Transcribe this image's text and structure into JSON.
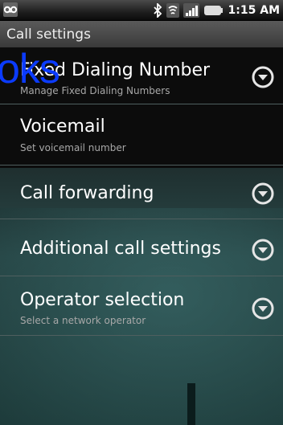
{
  "status_bar": {
    "time": "1:15 AM",
    "icons": [
      "voicemail-icon",
      "bluetooth-icon",
      "wifi-icon",
      "signal-icon",
      "battery-icon"
    ]
  },
  "title": "Call settings",
  "overlay_text": "oks",
  "items": [
    {
      "title": "Fixed Dialing Number",
      "subtitle": "Manage Fixed Dialing Numbers",
      "has_arrow": true
    },
    {
      "title": "Voicemail",
      "subtitle": "Set voicemail number",
      "has_arrow": false
    },
    {
      "title": "Call forwarding",
      "subtitle": "",
      "has_arrow": true
    },
    {
      "title": "Additional call settings",
      "subtitle": "",
      "has_arrow": true
    },
    {
      "title": "Operator selection",
      "subtitle": "Select a network operator",
      "has_arrow": true
    }
  ],
  "colors": {
    "overlay": "#0b3bff",
    "chevron": "#e6e6e6",
    "subtitle": "#a8a8a8"
  }
}
